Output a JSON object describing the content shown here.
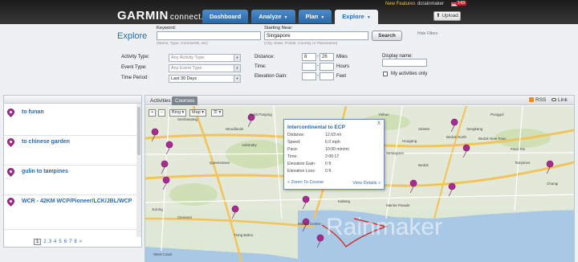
{
  "header": {
    "logo_brand": "GARMIN",
    "logo_product": "connect.",
    "new_features": "New Features",
    "username": "dcrainmaker",
    "mail_count": "143",
    "upload_label": "Upload",
    "tabs": [
      {
        "label": "Dashboard",
        "caret": false,
        "active": false
      },
      {
        "label": "Analyze",
        "caret": true,
        "active": false
      },
      {
        "label": "Plan",
        "caret": true,
        "active": false
      },
      {
        "label": "Explore",
        "caret": true,
        "active": true
      }
    ]
  },
  "search": {
    "title": "Explore",
    "keyword_label": "Keyword:",
    "keyword_value": "",
    "keyword_hint": "(Name, Type, Comments, etc)",
    "near_label": "Starting Near:",
    "near_value": "Singapore",
    "near_hint": "(City, State, Postal, Country or Placename)",
    "search_button": "Search",
    "hide_filters": "Hide Filters"
  },
  "filters": {
    "activity_type_label": "Activity Type:",
    "activity_type_value": "Any Activity Type",
    "event_type_label": "Event Type:",
    "event_type_value": "Any Event Type",
    "time_period_label": "Time Period:",
    "time_period_value": "Last 30 Days",
    "distance_label": "Distance:",
    "distance_min": "8",
    "distance_max": "26",
    "distance_unit": "Miles",
    "time_label": "Time:",
    "time_unit": "Hours",
    "elevation_label": "Elevation Gain:",
    "elevation_unit": "Feet",
    "range_dash": "-",
    "display_name_label": "Display name:",
    "display_name_value": "",
    "my_activities_label": "My activities only"
  },
  "results": {
    "items": [
      {
        "name": "to funan"
      },
      {
        "name": "to chinese garden"
      },
      {
        "name": "gulin to tampines"
      },
      {
        "name": "WCR - 42KM WCP/Pioneer/LCK/JBL/WCP"
      }
    ],
    "pages": [
      "1",
      "2",
      "3",
      "4",
      "5",
      "6",
      "7",
      "8",
      "»"
    ],
    "current_page": "1"
  },
  "map": {
    "tab_activities": "Activities",
    "tab_courses": "Courses",
    "rss": "RSS",
    "link": "Link",
    "ctrl_plus": "+",
    "ctrl_minus": "−",
    "ctrl_provider": "Bing",
    "ctrl_type": "Map",
    "ctrl_layers": "☰",
    "watermark": "Rainmaker",
    "labels": [
      "Sembawang",
      "Woodlands",
      "Admiralty",
      "Yishun",
      "Punggol",
      "Sengkang",
      "Seletar",
      "Ang Mo Kio",
      "Hougang",
      "Pasir Ris",
      "Tampines",
      "Bedok North",
      "Bedok New Town",
      "Bukit Panjang",
      "Toa Payoh",
      "Queenstown",
      "Geylang",
      "Bedok",
      "Marina Centre",
      "Tiong Bahru",
      "Jurong",
      "Clementi",
      "West Coast",
      "Changi",
      "Marine Parade",
      "Kallang",
      "Novena",
      "Serangoon"
    ]
  },
  "popup": {
    "title": "Intercontinental to ECP",
    "close": "X",
    "rows": [
      {
        "label": "Distance:",
        "value": "12.63 mi"
      },
      {
        "label": "Speed:",
        "value": "6.0 mph"
      },
      {
        "label": "Pace:",
        "value": "10:00 min/mi"
      },
      {
        "label": "Time:",
        "value": "2:06:17"
      },
      {
        "label": "Elevation Gain:",
        "value": "0 ft"
      },
      {
        "label": "Elevation Loss:",
        "value": "0 ft"
      }
    ],
    "zoom_link": "Zoom To Course",
    "details_link": "View Details »"
  }
}
